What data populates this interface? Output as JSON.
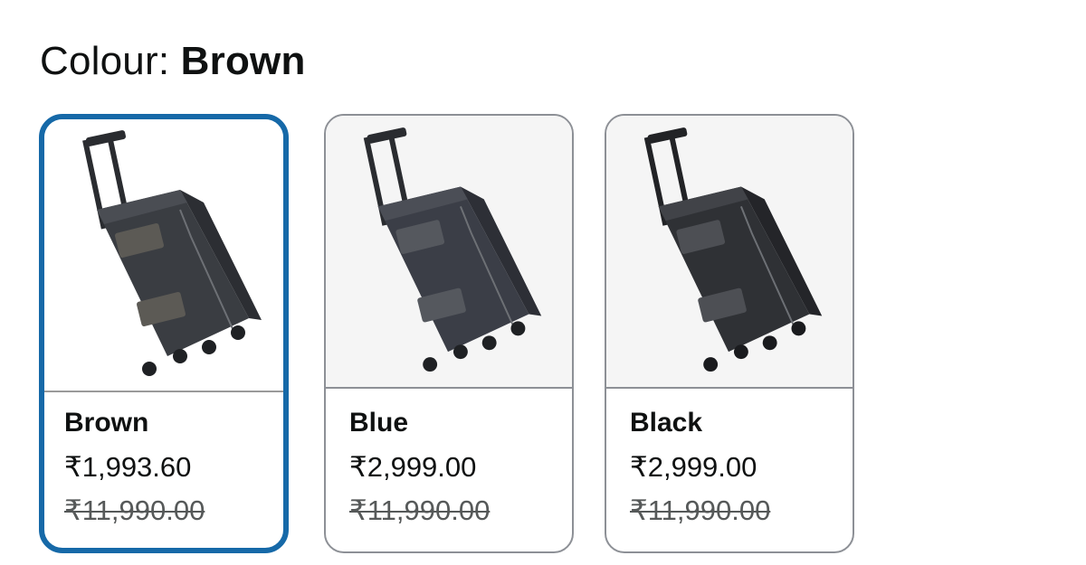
{
  "selector": {
    "label": "Colour: ",
    "selected_value": "Brown"
  },
  "swatches": [
    {
      "name": "Brown",
      "price": "₹1,993.60",
      "mrp": "₹11,990.00",
      "selected": true,
      "image_icon": "trolley-bag-icon"
    },
    {
      "name": "Blue",
      "price": "₹2,999.00",
      "mrp": "₹11,990.00",
      "selected": false,
      "image_icon": "trolley-bag-icon"
    },
    {
      "name": "Black",
      "price": "₹2,999.00",
      "mrp": "₹11,990.00",
      "selected": false,
      "image_icon": "trolley-bag-icon"
    }
  ],
  "colors": {
    "selected_border": "#1669a8",
    "default_border": "#8d9096",
    "mrp_text": "#565959",
    "bag_body": "#3a3d42"
  }
}
